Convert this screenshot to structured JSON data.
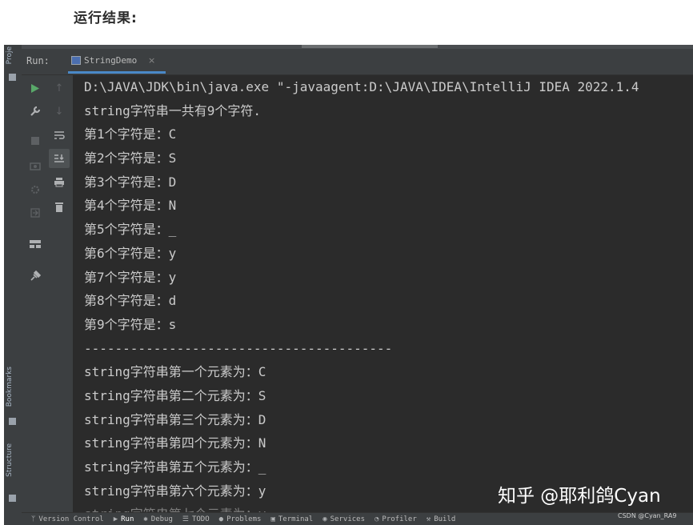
{
  "page": {
    "heading": "运行结果:"
  },
  "left_strip": {
    "project_label": "Proje",
    "bookmarks_label": "Bookmarks",
    "structure_label": "Structure"
  },
  "run_panel": {
    "run_label": "Run:",
    "tab_label": "StringDemo",
    "tab_close": "×"
  },
  "console": {
    "lines": [
      "D:\\JAVA\\JDK\\bin\\java.exe \"-javaagent:D:\\JAVA\\IDEA\\IntelliJ IDEA 2022.1.4",
      "string字符串一共有9个字符.",
      "第1个字符是：C",
      "第2个字符是：S",
      "第3个字符是：D",
      "第4个字符是：N",
      "第5个字符是：_",
      "第6个字符是：y",
      "第7个字符是：y",
      "第8个字符是：d",
      "第9个字符是：s",
      "----------------------------------------",
      "string字符串第一个元素为：C",
      "string字符串第二个元素为：S",
      "string字符串第三个元素为：D",
      "string字符串第四个元素为：N",
      "string字符串第五个元素为：_",
      "string字符串第六个元素为：y",
      "string字符串第七个元素为：y"
    ]
  },
  "statusbar": {
    "version_control": "Version Control",
    "run": "Run",
    "debug": "Debug",
    "todo": "TODO",
    "problems": "Problems",
    "terminal": "Terminal",
    "services": "Services",
    "profiler": "Profiler",
    "build": "Build"
  },
  "watermark": {
    "zhihu": "知乎 @耶利鸽Cyan",
    "csdn": "CSDN @Cyan_RA9"
  },
  "colors": {
    "ide_bg": "#2b2b2b",
    "panel_bg": "#3c3f41",
    "text": "#cbcbcb",
    "accent": "#4a88c7",
    "run_green": "#59a869"
  }
}
